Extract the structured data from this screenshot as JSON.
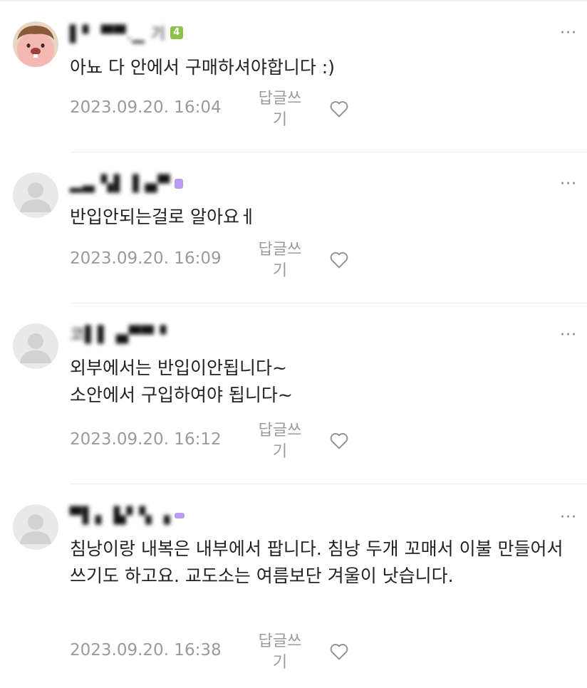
{
  "comments": [
    {
      "author": "▌▘ ▀▀.▁ 기",
      "level_badge": "4",
      "badge_color": "#8bc34a",
      "avatar": "cartoon-beaver-avatar",
      "text": "아뇨 다 안에서 구매하셔야합니다 :)",
      "timestamp": "2023.09.20. 16:04",
      "reply_label": "답글쓰기"
    },
    {
      "author": "▂▃ ▚▌▐ ▄▀",
      "level_badge": "",
      "badge_color": "#b79cf2",
      "avatar": "default-profile-avatar",
      "text": "반입안되는걸로 알아요ㅔ",
      "timestamp": "2023.09.20. 16:09",
      "reply_label": "답글쓰기"
    },
    {
      "author": "코▌▌ ▄▀▀ ▘",
      "level_badge": "",
      "badge_color": "",
      "avatar": "default-profile-avatar",
      "text": "외부에서는 반입이안됩니다~\n소안에서 구입하여야 됩니다~",
      "timestamp": "2023.09.20. 16:12",
      "reply_label": "답글쓰기"
    },
    {
      "author": "▀▌▖ ▙▘▚ ▗",
      "level_badge": "",
      "badge_color": "#b79cf2",
      "avatar": "default-profile-avatar",
      "text": "침낭이랑 내복은 내부에서 팝니다. 침낭 두개 꼬매서 이불 만들어서 쓰기도 하고요. 교도소는 여름보단 겨울이 낫습니다.",
      "timestamp": "2023.09.20. 16:38",
      "reply_label": "답글쓰기"
    }
  ],
  "more_label": "···"
}
